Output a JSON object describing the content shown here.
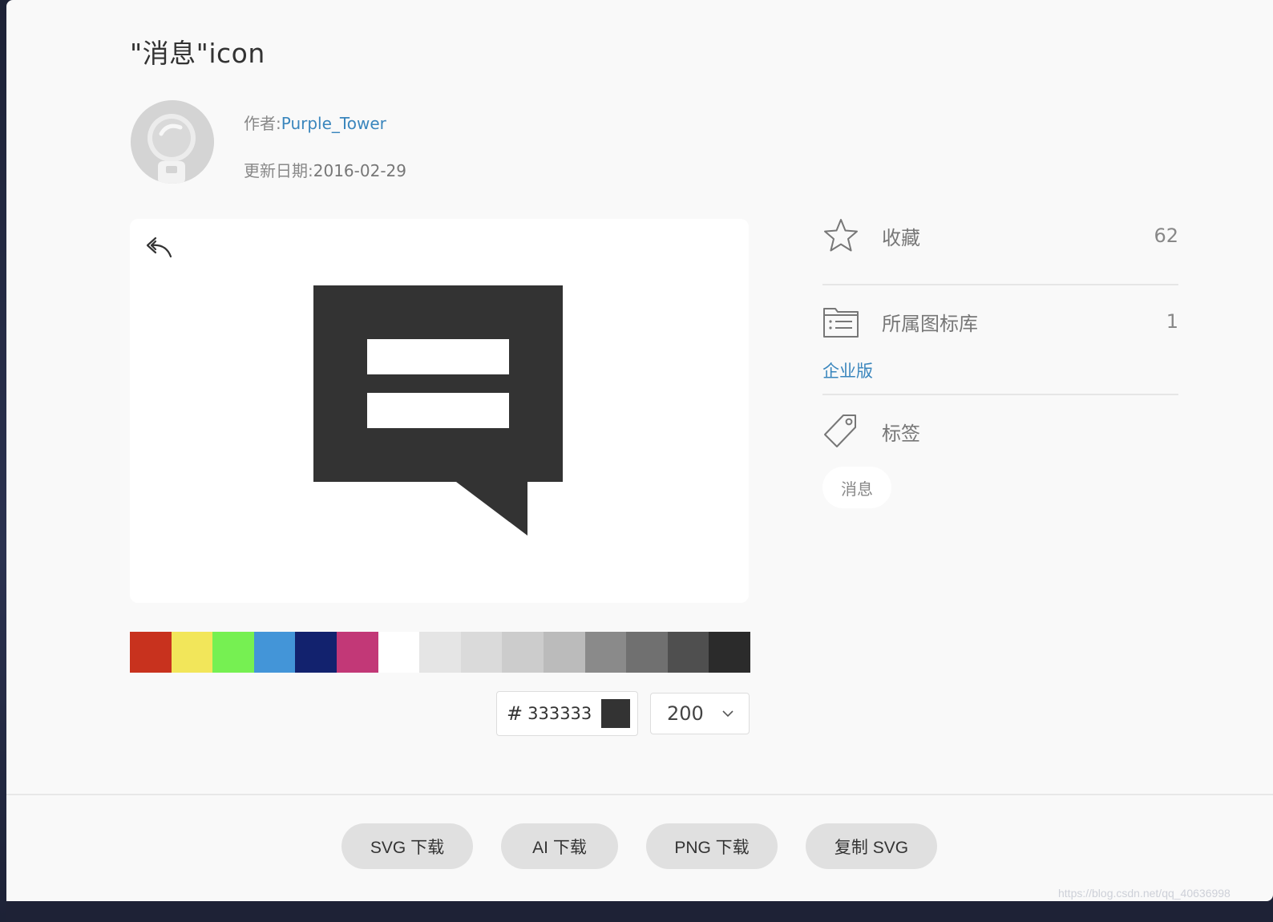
{
  "icon_title": "\"消息\"icon",
  "author": {
    "label": "作者:",
    "name": "Purple_Tower"
  },
  "updated": {
    "label": "更新日期:",
    "date": "2016-02-29"
  },
  "palette": [
    "#c8321e",
    "#f2e65a",
    "#76f052",
    "#4395d8",
    "#12226e",
    "#c23877",
    "#ffffff",
    "#e5e5e5",
    "#dadada",
    "#cccccc",
    "#bbbbbb",
    "#8a8a8a",
    "#707070",
    "#4f4f4f",
    "#2b2b2b"
  ],
  "color": {
    "hash": "#",
    "hex": "333333",
    "chip": "#333333"
  },
  "size": {
    "value": "200"
  },
  "sidebar": {
    "favorite": {
      "label": "收藏",
      "count": "62"
    },
    "library": {
      "label": "所属图标库",
      "count": "1",
      "link": "企业版"
    },
    "tags": {
      "label": "标签",
      "items": [
        "消息"
      ]
    }
  },
  "downloads": {
    "svg": "SVG 下载",
    "ai": "AI 下载",
    "png": "PNG 下载",
    "copy": "复制 SVG"
  },
  "watermark": "https://blog.csdn.net/qq_40636998"
}
